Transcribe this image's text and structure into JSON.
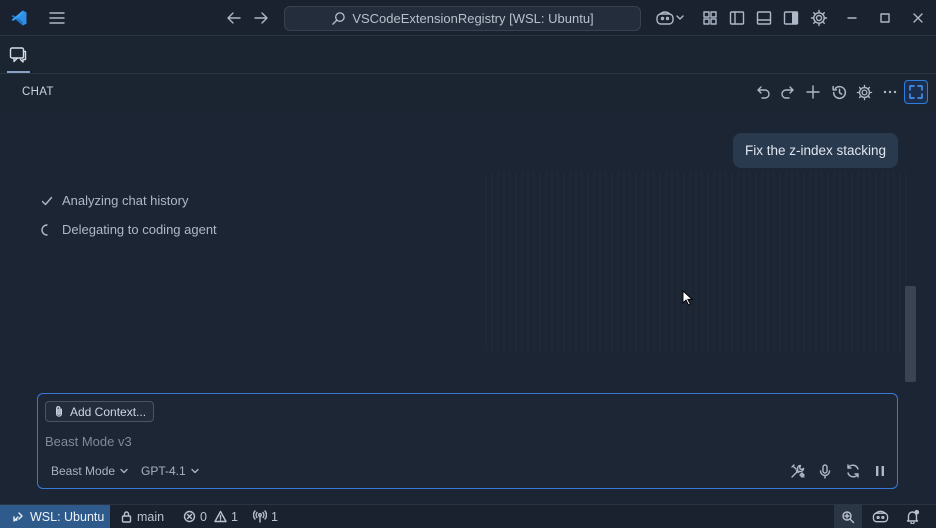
{
  "titlebar": {
    "search_text": "VSCodeExtensionRegistry [WSL: Ubuntu]"
  },
  "chat_header": {
    "title": "CHAT"
  },
  "messages": {
    "user": "Fix the z-index stacking"
  },
  "progress": [
    {
      "status": "done",
      "label": "Analyzing chat history"
    },
    {
      "status": "running",
      "label": "Delegating to coding agent"
    }
  ],
  "input": {
    "add_context_label": "Add Context...",
    "placeholder": "Beast Mode v3",
    "mode_label": "Beast Mode",
    "model_label": "GPT-4.1"
  },
  "statusbar": {
    "remote_label": "WSL: Ubuntu",
    "branch": "main",
    "errors": "0",
    "warnings": "1",
    "ports": "1"
  },
  "colors": {
    "accent": "#3a78d8",
    "remote_bg": "#2f5a8c",
    "vscode_blue": "#2f8fe6"
  }
}
